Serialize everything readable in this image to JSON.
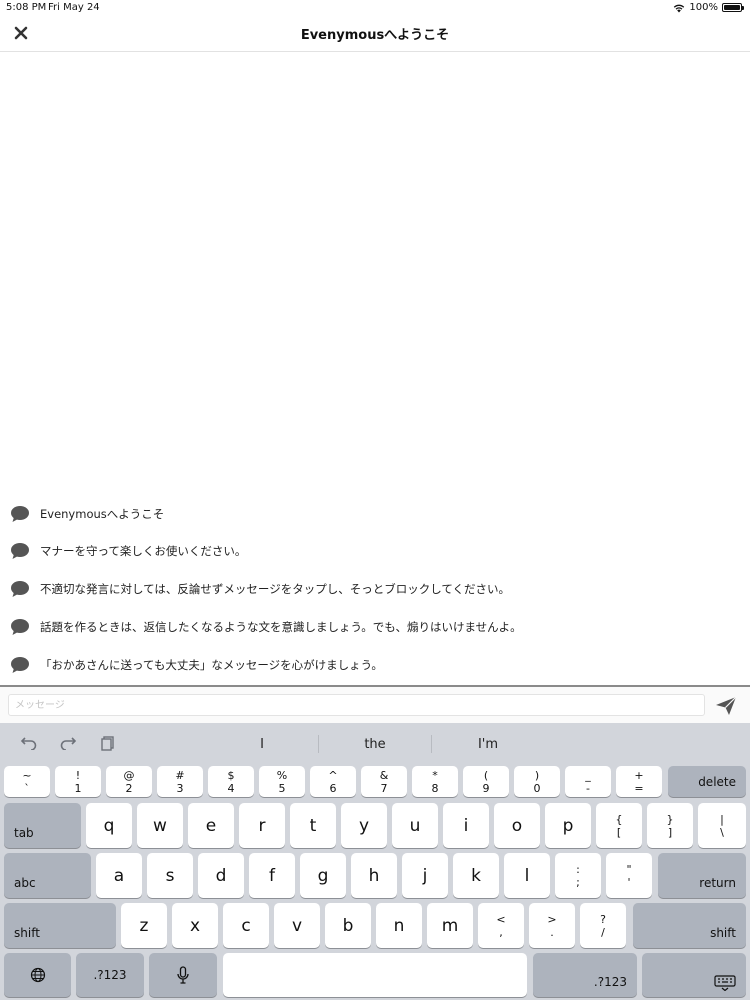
{
  "status": {
    "time": "5:08 PM",
    "date": "Fri May 24",
    "battery": "100%"
  },
  "navbar": {
    "title": "Evenymousへようこそ",
    "close_icon": "close-icon"
  },
  "messages": [
    "Evenymousへようこそ",
    "マナーを守って楽しくお使いください。",
    "不適切な発言に対しては、反論せずメッセージをタップし、そっとブロックしてください。",
    "話題を作るときは、返信したくなるような文を意識しましょう。でも、煽りはいけませんよ。",
    "「おかあさんに送っても大丈夫」なメッセージを心がけましょう。"
  ],
  "input": {
    "placeholder": "メッセージ",
    "value": ""
  },
  "keyboard": {
    "suggestions": [
      "I",
      "the",
      "I'm"
    ],
    "num_row": [
      {
        "top": "~",
        "bottom": "`"
      },
      {
        "top": "!",
        "bottom": "1"
      },
      {
        "top": "@",
        "bottom": "2"
      },
      {
        "top": "#",
        "bottom": "3"
      },
      {
        "top": "$",
        "bottom": "4"
      },
      {
        "top": "%",
        "bottom": "5"
      },
      {
        "top": "^",
        "bottom": "6"
      },
      {
        "top": "&",
        "bottom": "7"
      },
      {
        "top": "*",
        "bottom": "8"
      },
      {
        "top": "(",
        "bottom": "9"
      },
      {
        "top": ")",
        "bottom": "0"
      },
      {
        "top": "_",
        "bottom": "-"
      },
      {
        "top": "+",
        "bottom": "="
      }
    ],
    "delete": "delete",
    "tab": "tab",
    "row1": [
      "q",
      "w",
      "e",
      "r",
      "t",
      "y",
      "u",
      "i",
      "o",
      "p"
    ],
    "row1_extra": [
      {
        "top": "{",
        "bottom": "["
      },
      {
        "top": "}",
        "bottom": "]"
      },
      {
        "top": "|",
        "bottom": "\\"
      }
    ],
    "caps": "abc",
    "row2": [
      "a",
      "s",
      "d",
      "f",
      "g",
      "h",
      "j",
      "k",
      "l"
    ],
    "row2_extra": [
      {
        "top": ":",
        "bottom": ";"
      },
      {
        "top": "\"",
        "bottom": "'"
      }
    ],
    "return": "return",
    "shift": "shift",
    "row3": [
      "z",
      "x",
      "c",
      "v",
      "b",
      "n",
      "m"
    ],
    "row3_extra": [
      {
        "top": "<",
        "bottom": ","
      },
      {
        "top": ">",
        "bottom": "."
      },
      {
        "top": "?",
        "bottom": "/"
      }
    ],
    "numbers": ".?123"
  }
}
